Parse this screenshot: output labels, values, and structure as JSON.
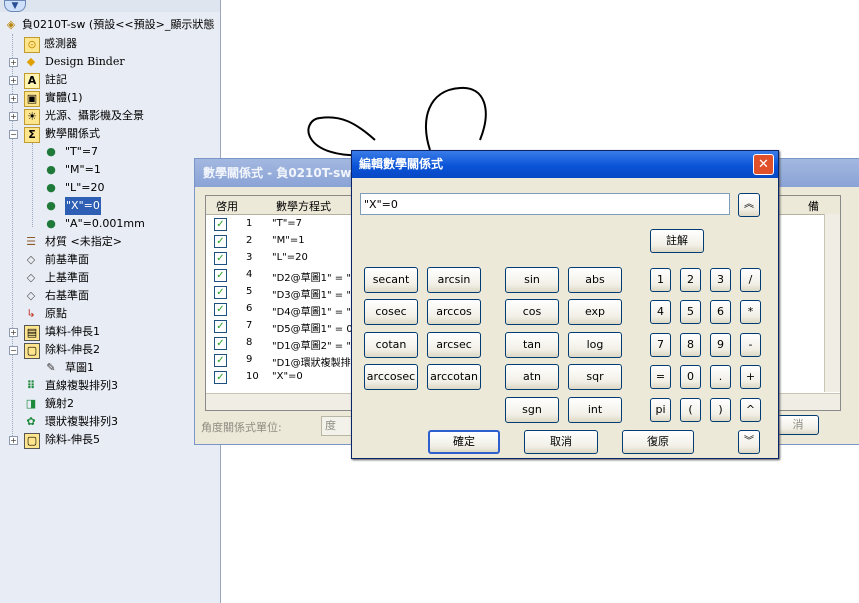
{
  "tree": {
    "filter_icon": "filter-icon",
    "root_label": "負0210T-sw  (預設<<預設>_顯示狀態",
    "items": [
      {
        "label": "感測器"
      },
      {
        "label": "Design Binder"
      },
      {
        "label": "註記"
      },
      {
        "label": "實體(1)"
      },
      {
        "label": "光源、攝影機及全景"
      },
      {
        "label": "數學關係式"
      },
      {
        "label": "\"T\"=7"
      },
      {
        "label": "\"M\"=1"
      },
      {
        "label": "\"L\"=20"
      },
      {
        "label": "\"X\"=0"
      },
      {
        "label": "\"A\"=0.001mm"
      },
      {
        "label": "材質 <未指定>"
      },
      {
        "label": "前基準面"
      },
      {
        "label": "上基準面"
      },
      {
        "label": "右基準面"
      },
      {
        "label": "原點"
      },
      {
        "label": "填料-伸長1"
      },
      {
        "label": "除料-伸長2"
      },
      {
        "label": "草圖1"
      },
      {
        "label": "直線複製排列3"
      },
      {
        "label": "鏡射2"
      },
      {
        "label": "環狀複製排列3"
      },
      {
        "label": "除料-伸長5"
      }
    ]
  },
  "equations_window": {
    "title": "數學關係式 - 負0210T-sw",
    "col_enable": "啓用",
    "col_equation": "數學方程式",
    "col_notes": "備",
    "rows": [
      {
        "num": "1",
        "text": "\"T\"=7"
      },
      {
        "num": "2",
        "text": "\"M\"=1"
      },
      {
        "num": "3",
        "text": "\"L\"=20"
      },
      {
        "num": "4",
        "text": "\"D2@草圖1\" = \""
      },
      {
        "num": "5",
        "text": "\"D3@草圖1\" = \""
      },
      {
        "num": "6",
        "text": "\"D4@草圖1\" = \""
      },
      {
        "num": "7",
        "text": "\"D5@草圖1\" = 0"
      },
      {
        "num": "8",
        "text": "\"D1@草圖2\" = \""
      },
      {
        "num": "9",
        "text": "\"D1@環狀複製排"
      },
      {
        "num": "10",
        "text": "\"X\"=0"
      }
    ],
    "unit_label": "角度關係式單位:",
    "unit_value": "度",
    "partial_button": "消"
  },
  "editor": {
    "title": "編輯數學關係式",
    "expression": "\"X\"=0",
    "comment_button": "註解",
    "functions": [
      "secant",
      "arcsin",
      "sin",
      "abs",
      "cosec",
      "arccos",
      "cos",
      "exp",
      "cotan",
      "arcsec",
      "tan",
      "log",
      "arccosec",
      "arccotan",
      "atn",
      "sqr",
      "sgn",
      "int"
    ],
    "keys": [
      "1",
      "2",
      "3",
      "/",
      "4",
      "5",
      "6",
      "*",
      "7",
      "8",
      "9",
      "-",
      "=",
      "0",
      ".",
      "+",
      "pi",
      "(",
      ")",
      "^"
    ],
    "ok": "確定",
    "cancel": "取消",
    "undo": "復原",
    "colors": {
      "title_bar": "#0a54d8",
      "close": "#e0512b",
      "check": "#21a121"
    }
  }
}
